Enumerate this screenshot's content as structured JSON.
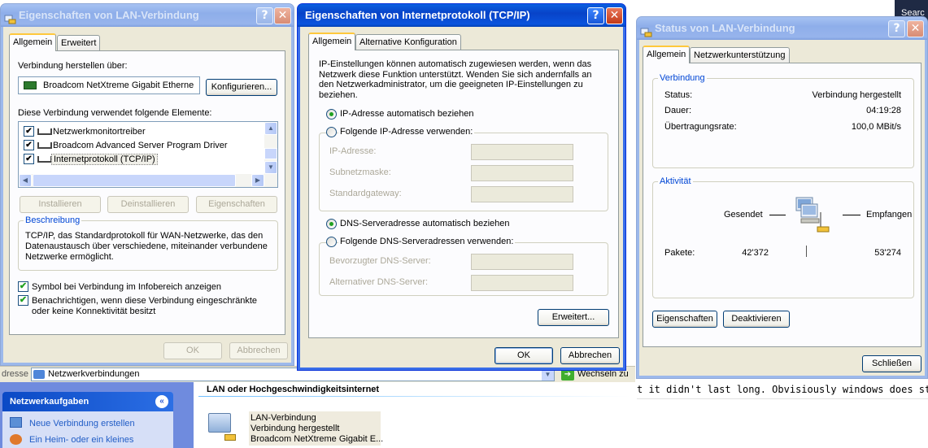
{
  "background": {
    "search_label": "Searc",
    "go_label": "Wechseln zu",
    "forum_text": "t it didn't last long. Obvisiously windows does still DHC",
    "address": {
      "label": "dresse",
      "value": "Netzwerkverbindungen"
    },
    "taskpane": {
      "title": "Netzwerkaufgaben",
      "items": [
        "Neue Verbindung erstellen",
        "Ein Heim- oder ein kleines"
      ]
    },
    "content": {
      "group_title": "LAN oder Hochgeschwindigkeitsinternet",
      "connection": {
        "name": "LAN-Verbindung",
        "status": "Verbindung hergestellt",
        "device": "Broadcom NetXtreme Gigabit E..."
      }
    }
  },
  "lan_props": {
    "title": "Eigenschaften von LAN-Verbindung",
    "tabs": [
      "Allgemein",
      "Erweitert"
    ],
    "connect_via_label": "Verbindung herstellen über:",
    "adapter": "Broadcom NetXtreme Gigabit Etherne",
    "configure_button": "Konfigurieren...",
    "elements_label": "Diese Verbindung verwendet folgende Elemente:",
    "items": [
      "Netzwerkmonitortreiber",
      "Broadcom Advanced Server Program Driver",
      "Internetprotokoll (TCP/IP)"
    ],
    "install_button": "Installieren",
    "uninstall_button": "Deinstallieren",
    "properties_button": "Eigenschaften",
    "description_title": "Beschreibung",
    "description_text": "TCP/IP, das Standardprotokoll für WAN-Netzwerke, das den Datenaustausch über verschiedene, miteinander verbundene Netzwerke ermöglicht.",
    "check_tray": "Symbol bei Verbindung im Infobereich anzeigen",
    "check_notify": "Benachrichtigen, wenn diese Verbindung eingeschränkte oder keine Konnektivität besitzt",
    "ok_button": "OK",
    "cancel_button": "Abbrechen"
  },
  "tcpip": {
    "title": "Eigenschaften von Internetprotokoll (TCP/IP)",
    "tabs": [
      "Allgemein",
      "Alternative Konfiguration"
    ],
    "intro": "IP-Einstellungen können automatisch zugewiesen werden, wenn das Netzwerk diese Funktion unterstützt. Wenden Sie sich andernfalls an den Netzwerkadministrator, um die geeigneten IP-Einstellungen zu beziehen.",
    "radio_ip_auto": "IP-Adresse automatisch beziehen",
    "radio_ip_manual": "Folgende IP-Adresse verwenden:",
    "ip_label": "IP-Adresse:",
    "subnet_label": "Subnetzmaske:",
    "gateway_label": "Standardgateway:",
    "radio_dns_auto": "DNS-Serveradresse automatisch beziehen",
    "radio_dns_manual": "Folgende DNS-Serveradressen verwenden:",
    "dns_pref_label": "Bevorzugter DNS-Server:",
    "dns_alt_label": "Alternativer DNS-Server:",
    "advanced_button": "Erweitert...",
    "ok_button": "OK",
    "cancel_button": "Abbrechen"
  },
  "status": {
    "title": "Status von LAN-Verbindung",
    "tabs": [
      "Allgemein",
      "Netzwerkunterstützung"
    ],
    "connection_group": "Verbindung",
    "status_label": "Status:",
    "status_value": "Verbindung hergestellt",
    "duration_label": "Dauer:",
    "duration_value": "04:19:28",
    "speed_label": "Übertragungsrate:",
    "speed_value": "100,0 MBit/s",
    "activity_group": "Aktivität",
    "sent_label": "Gesendet",
    "received_label": "Empfangen",
    "packets_label": "Pakete:",
    "packets_sent": "42'372",
    "packets_received": "53'274",
    "properties_button": "Eigenschaften",
    "disable_button": "Deaktivieren",
    "close_button": "Schließen"
  }
}
